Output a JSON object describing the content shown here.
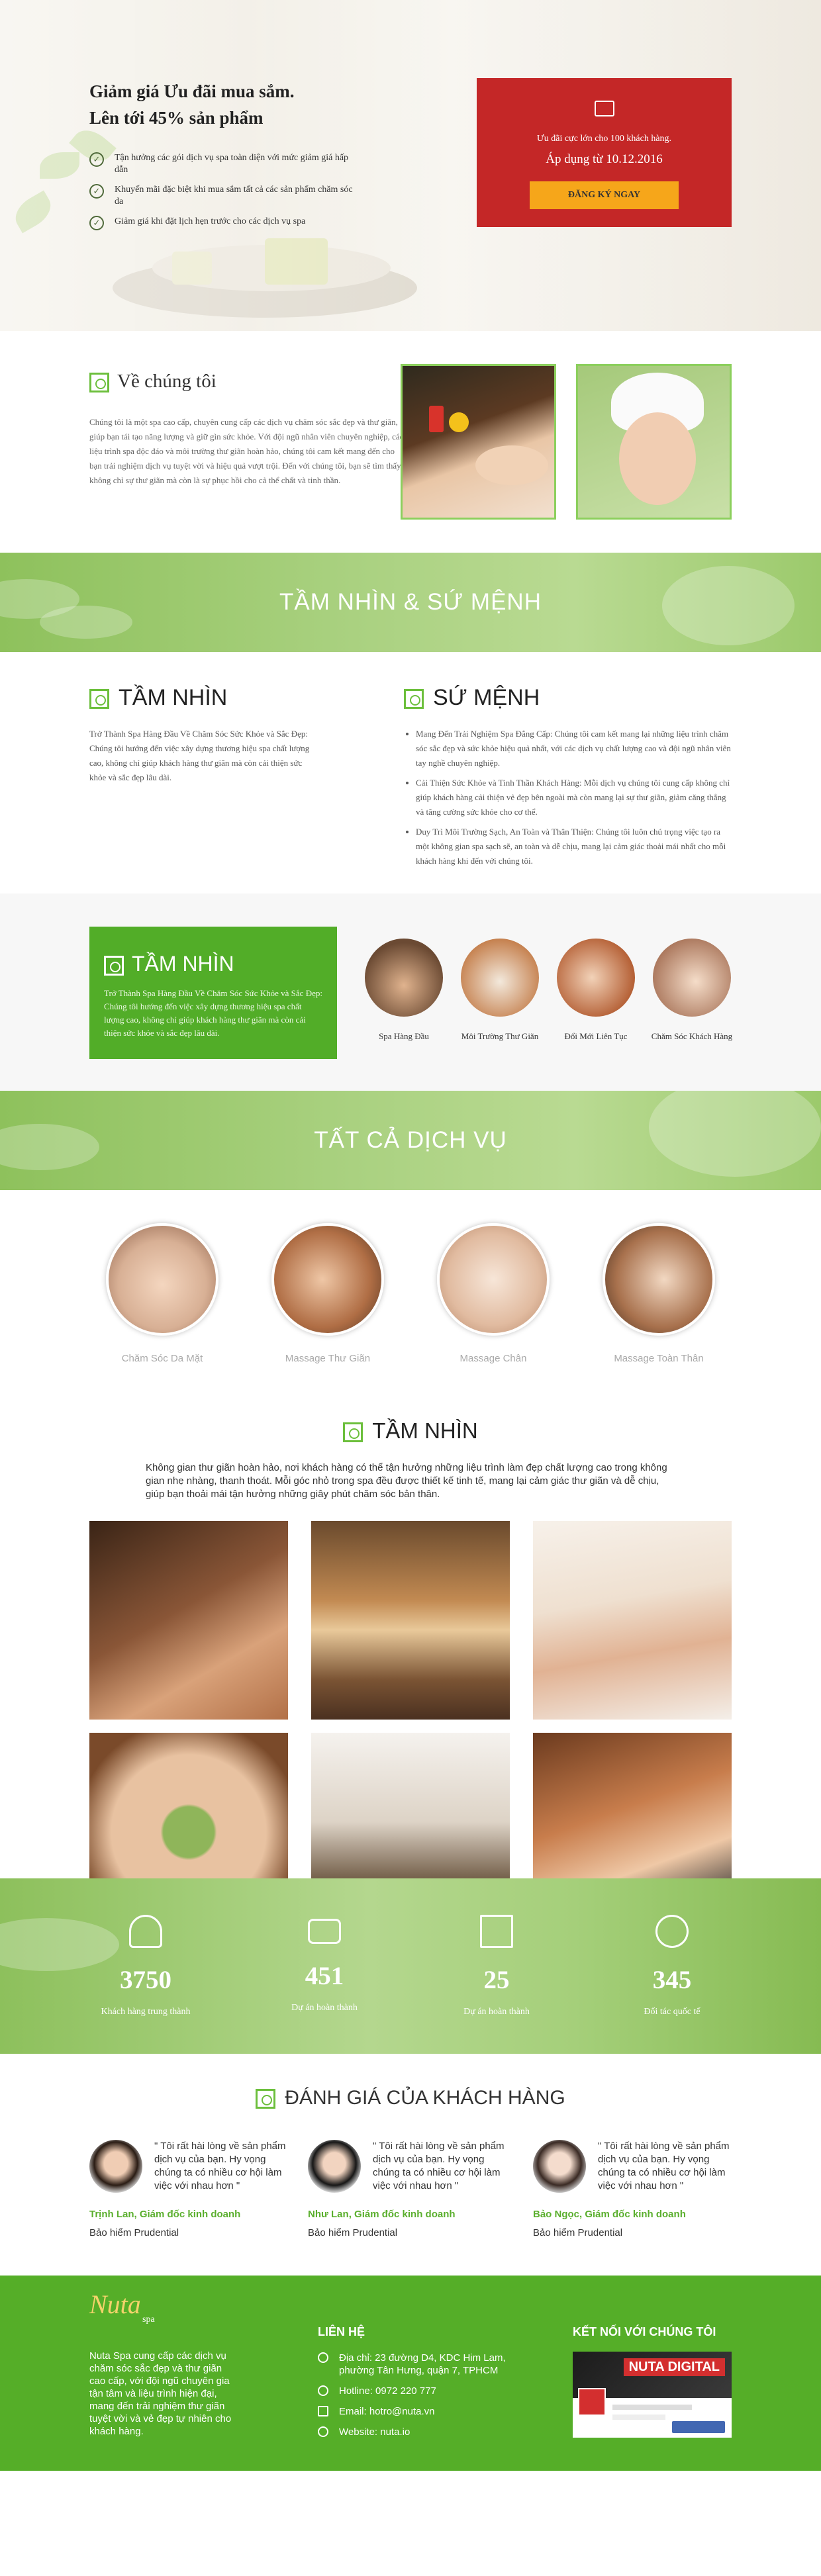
{
  "hero": {
    "title_line1": "Giảm giá Ưu đãi mua sắm.",
    "title_line2": "Lên tới 45% sản phẩm",
    "bullets": [
      "Tận hưởng các gói dịch vụ spa toàn diện với mức giảm giá hấp dẫn",
      "Khuyến mãi đặc biệt khi mua sắm tất cả các sản phẩm chăm sóc da",
      "Giảm giá khi đặt lịch hẹn trước cho các dịch vụ spa"
    ],
    "promo": {
      "icon": "calendar-icon",
      "text": "Ưu đãi cực lớn cho 100 khách hàng.",
      "date": "Áp dụng từ 10.12.2016",
      "button": "ĐĂNG KÝ NGAY"
    }
  },
  "about": {
    "title": "Về chúng tôi",
    "text": "Chúng tôi là một spa cao cấp, chuyên cung cấp các dịch vụ chăm sóc sắc đẹp và thư giãn, giúp bạn tái tạo năng lượng và giữ gìn sức khỏe. Với đội ngũ nhân viên chuyên nghiệp, các liệu trình spa độc đáo và môi trường thư giãn hoàn hảo, chúng tôi cam kết mang đến cho bạn trải nghiệm dịch vụ tuyệt vời và hiệu quả vượt trội. Đến với chúng tôi, bạn sẽ tìm thấy không chỉ sự thư giãn mà còn là sự phục hồi cho cả thể chất và tinh thần."
  },
  "banner1": {
    "title": "TẦM NHÌN & SỨ MỆNH"
  },
  "vision": {
    "title": "TẦM NHÌN",
    "text": "Trở Thành Spa Hàng Đầu Về Chăm Sóc Sức Khỏe và Sắc Đẹp: Chúng tôi hướng đến việc xây dựng thương hiệu spa chất lượng cao, không chỉ giúp khách hàng thư giãn mà còn cải thiện sức khỏe và sắc đẹp lâu dài."
  },
  "mission": {
    "title": "SỨ MỆNH",
    "items": [
      "Mang Đến Trải Nghiệm Spa Đẳng Cấp: Chúng tôi cam kết mang lại những liệu trình chăm sóc sắc đẹp và sức khỏe hiệu quả nhất, với các dịch vụ chất lượng cao và đội ngũ nhân viên tay nghề chuyên nghiệp.",
      "Cải Thiện Sức Khỏe và Tinh Thần Khách Hàng: Mỗi dịch vụ chúng tôi cung cấp không chỉ giúp khách hàng cải thiện vẻ đẹp bên ngoài mà còn mang lại sự thư giãn, giảm căng thẳng và tăng cường sức khỏe cho cơ thể.",
      "Duy Trì Môi Trường Sạch, An Toàn và Thân Thiện: Chúng tôi luôn chú trọng việc tạo ra một không gian spa sạch sẽ, an toàn và dễ chịu, mang lại cảm giác thoải mái nhất cho mỗi khách hàng khi đến với chúng tôi."
    ]
  },
  "vision_box": {
    "title": "TẦM NHÌN",
    "text": "Trở Thành Spa Hàng Đầu Về Chăm Sóc Sức Khỏe và Sắc Đẹp: Chúng tôi hướng đến việc xây dựng thương hiệu spa chất lượng cao, không chỉ giúp khách hàng thư giãn mà còn cải thiện sức khỏe và sắc đẹp lâu dài.",
    "features": [
      "Spa Hàng Đầu",
      "Môi Trường Thư Giãn",
      "Đổi Mới Liên Tục",
      "Chăm Sóc Khách Hàng"
    ]
  },
  "banner2": {
    "title": "TẤT CẢ DỊCH VỤ"
  },
  "services": [
    "Chăm Sóc Da Mặt",
    "Massage Thư Giãn",
    "Massage Chân",
    "Massage Toàn Thân"
  ],
  "gallery": {
    "title": "TẦM NHÌN",
    "text": "Không gian thư giãn hoàn hảo, nơi khách hàng có thể tận hưởng những liệu trình làm đẹp chất lượng cao trong không gian nhẹ nhàng, thanh thoát. Mỗi góc nhỏ trong spa đều được thiết kế tinh tế, mang lại cảm giác thư giãn và dễ chịu, giúp bạn thoải mái tận hưởng những giây phút chăm sóc bản thân."
  },
  "stats": [
    {
      "icon": "user-icon",
      "value": "3750",
      "label": "Khách hàng trung thành"
    },
    {
      "icon": "credit-card-icon",
      "value": "451",
      "label": "Dự án hoàn thành"
    },
    {
      "icon": "box-icon",
      "value": "25",
      "label": "Dự án hoàn thành"
    },
    {
      "icon": "globe-icon",
      "value": "345",
      "label": "Đối tác quốc tế"
    }
  ],
  "reviews": {
    "title": "ĐÁNH GIÁ CỦA KHÁCH HÀNG",
    "items": [
      {
        "quote": "\" Tôi rất hài lòng về sản phẩm dịch vụ của bạn. Hy vọng chúng ta có nhiều cơ hội làm việc với nhau hơn \"",
        "name": "Trịnh Lan, Giám đốc kinh doanh",
        "company": "Bảo hiểm Prudential"
      },
      {
        "quote": "\" Tôi rất hài lòng về sản phẩm dịch vụ của bạn. Hy vọng chúng ta có nhiều cơ hội làm việc với nhau hơn \"",
        "name": "Như Lan, Giám đốc kinh doanh",
        "company": "Bảo hiểm Prudential"
      },
      {
        "quote": "\" Tôi rất hài lòng về sản phẩm dịch vụ của bạn. Hy vọng chúng ta có nhiều cơ hội làm việc với nhau hơn \"",
        "name": "Bảo Ngọc, Giám đốc kinh doanh",
        "company": "Bảo hiểm Prudential"
      }
    ]
  },
  "footer": {
    "logo": "Nuta",
    "logo_sub": "spa",
    "about": "Nuta Spa cung cấp các dịch vụ chăm sóc sắc đẹp và thư giãn cao cấp, với đội ngũ chuyên gia tận tâm và liệu trình hiện đại, mang đến trải nghiệm thư giãn tuyệt vời và vẻ đẹp tự nhiên cho khách hàng.",
    "contact_title": "LIÊN HỆ",
    "contact": [
      {
        "icon": "location-icon",
        "text": "Địa chỉ: 23 đường D4, KDC Him Lam, phường Tân Hưng, quận 7, TPHCM"
      },
      {
        "icon": "phone-icon",
        "text": "Hotline: 0972 220 777"
      },
      {
        "icon": "mail-icon",
        "text": "Email: hotro@nuta.vn"
      },
      {
        "icon": "globe-icon",
        "text": "Website: nuta.io"
      }
    ],
    "social_title": "KẾT NỐI VỚI CHÚNG TÔI",
    "social_brand": "NUTA DIGITAL"
  }
}
